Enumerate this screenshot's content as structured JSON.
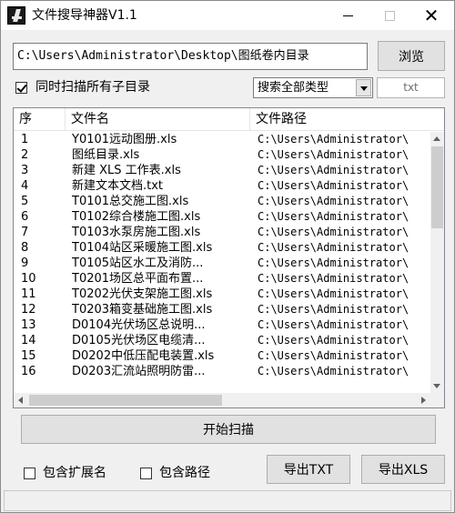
{
  "window": {
    "title": "文件搜导神器V1.1",
    "close_glyph": "✕"
  },
  "path": {
    "value": "C:\\Users\\Administrator\\Desktop\\图纸卷内目录",
    "browse_label": "浏览"
  },
  "options": {
    "scan_subfolders_label": "同时扫描所有子目录",
    "scan_subfolders_checked": true,
    "file_type_selected": "搜索全部类型",
    "extension_placeholder": "txt"
  },
  "list": {
    "columns": [
      "序",
      "文件名",
      "文件路径"
    ],
    "rows": [
      {
        "idx": "1",
        "name": "Y0101远动图册.xls",
        "path": "C:\\Users\\Administrator\\"
      },
      {
        "idx": "2",
        "name": "图纸目录.xls",
        "path": "C:\\Users\\Administrator\\"
      },
      {
        "idx": "3",
        "name": "新建 XLS 工作表.xls",
        "path": "C:\\Users\\Administrator\\"
      },
      {
        "idx": "4",
        "name": "新建文本文档.txt",
        "path": "C:\\Users\\Administrator\\"
      },
      {
        "idx": "5",
        "name": "T0101总交施工图.xls",
        "path": "C:\\Users\\Administrator\\"
      },
      {
        "idx": "6",
        "name": "T0102综合楼施工图.xls",
        "path": "C:\\Users\\Administrator\\"
      },
      {
        "idx": "7",
        "name": "T0103水泵房施工图.xls",
        "path": "C:\\Users\\Administrator\\"
      },
      {
        "idx": "8",
        "name": "T0104站区采暖施工图.xls",
        "path": "C:\\Users\\Administrator\\"
      },
      {
        "idx": "9",
        "name": "T0105站区水工及消防...",
        "path": "C:\\Users\\Administrator\\"
      },
      {
        "idx": "10",
        "name": "T0201场区总平面布置...",
        "path": "C:\\Users\\Administrator\\"
      },
      {
        "idx": "11",
        "name": "T0202光伏支架施工图.xls",
        "path": "C:\\Users\\Administrator\\"
      },
      {
        "idx": "12",
        "name": "T0203箱变基础施工图.xls",
        "path": "C:\\Users\\Administrator\\"
      },
      {
        "idx": "13",
        "name": "D0104光伏场区总说明...",
        "path": "C:\\Users\\Administrator\\"
      },
      {
        "idx": "14",
        "name": "D0105光伏场区电缆清...",
        "path": "C:\\Users\\Administrator\\"
      },
      {
        "idx": "15",
        "name": "D0202中低压配电装置.xls",
        "path": "C:\\Users\\Administrator\\"
      },
      {
        "idx": "16",
        "name": "D0203汇流站照明防雷...",
        "path": "C:\\Users\\Administrator\\"
      }
    ]
  },
  "actions": {
    "scan_label": "开始扫描",
    "include_ext_label": "包含扩展名",
    "include_ext_checked": false,
    "include_path_label": "包含路径",
    "include_path_checked": false,
    "export_txt_label": "导出TXT",
    "export_xls_label": "导出XLS"
  },
  "icons": {
    "app": "app-logo-icon",
    "minimize": "minimize-icon",
    "maximize": "maximize-icon",
    "close": "close-icon",
    "dropdown": "chevron-down-icon"
  }
}
